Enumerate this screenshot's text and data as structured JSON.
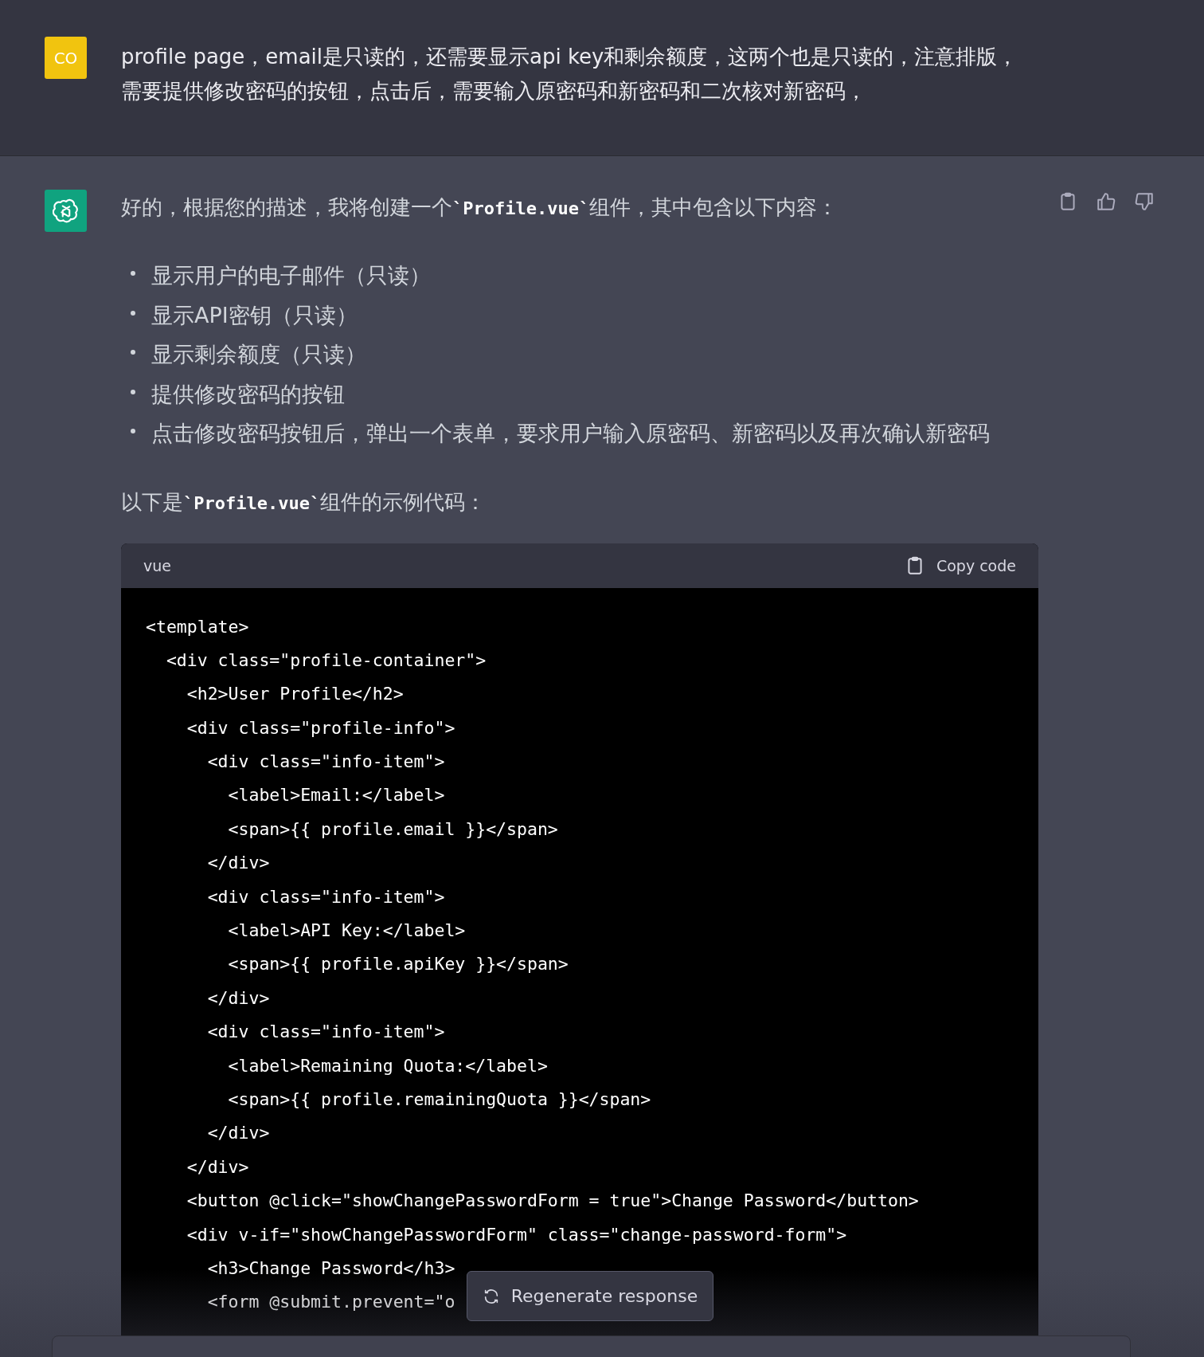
{
  "user_message": {
    "avatar": "CO",
    "text": "profile page，email是只读的，还需要显示api key和剩余额度，这两个也是只读的，注意排版，需要提供修改密码的按钮，点击后，需要输入原密码和新密码和二次核对新密码，"
  },
  "assistant_message": {
    "intro": "好的，根据您的描述，我将创建一个**`Profile.vue`**组件，其中包含以下内容：",
    "bullets": [
      "显示用户的电子邮件（只读）",
      "显示API密钥（只读）",
      "显示剩余额度（只读）",
      "提供修改密码的按钮",
      "点击修改密码按钮后，弹出一个表单，要求用户输入原密码、新密码以及再次确认新密码"
    ],
    "code_intro": "以下是**`Profile.vue`**组件的示例代码：",
    "code_block": {
      "language": "vue",
      "copy_label": "Copy code",
      "lines": [
        "<template>",
        "  <div class=\"profile-container\">",
        "    <h2>User Profile</h2>",
        "    <div class=\"profile-info\">",
        "      <div class=\"info-item\">",
        "        <label>Email:</label>",
        "        <span>{{ profile.email }}</span>",
        "      </div>",
        "      <div class=\"info-item\">",
        "        <label>API Key:</label>",
        "        <span>{{ profile.apiKey }}</span>",
        "      </div>",
        "      <div class=\"info-item\">",
        "        <label>Remaining Quota:</label>",
        "        <span>{{ profile.remainingQuota }}</span>",
        "      </div>",
        "    </div>",
        "    <button @click=\"showChangePasswordForm = true\">Change Password</button>",
        "    <div v-if=\"showChangePasswordForm\" class=\"change-password-form\">",
        "      <h3>Change Password</h3>",
        "      <form @submit.prevent=\"o"
      ]
    }
  },
  "regenerate_button": {
    "label": "Regenerate response"
  }
}
